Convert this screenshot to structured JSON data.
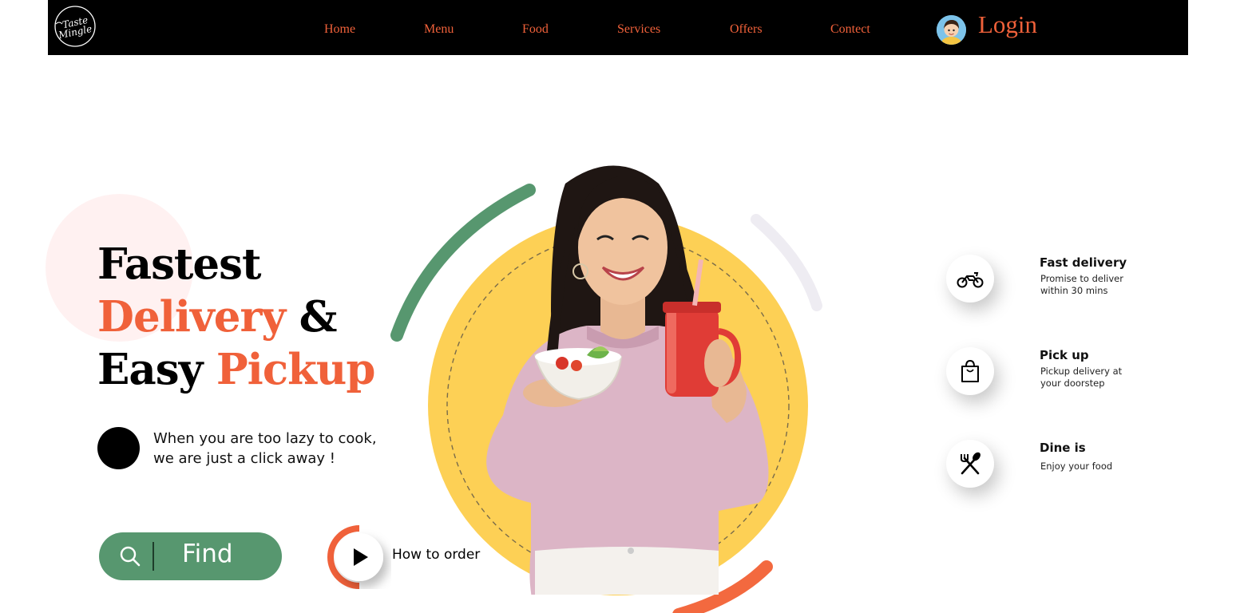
{
  "brand": {
    "logo_text_line1": "Taste",
    "logo_text_line2": "Mingle"
  },
  "nav": {
    "items": [
      {
        "label": "Home"
      },
      {
        "label": "Menu"
      },
      {
        "label": "Food"
      },
      {
        "label": "Services"
      },
      {
        "label": "Offers"
      },
      {
        "label": "Contect"
      }
    ],
    "login_label": "Login"
  },
  "hero": {
    "headline_line1": "Fastest",
    "headline_line2_accent": "Delivery",
    "headline_line2_rest": " &",
    "headline_line3_start": "Easy ",
    "headline_line3_accent": "Pickup",
    "tagline_line1": "When you are too lazy to cook,",
    "tagline_line2": "we are just a click away !",
    "find_label": "Find",
    "how_to_order_label": "How to order"
  },
  "features": [
    {
      "title": "Fast delivery",
      "desc_line1": "Promise to deliver",
      "desc_line2": "within 30 mins",
      "icon": "motorbike-icon"
    },
    {
      "title": "Pick up",
      "desc_line1": "Pickup delivery at",
      "desc_line2": "your doorstep",
      "icon": "shopping-bag-icon"
    },
    {
      "title": "Dine is",
      "desc_line1": "Enjoy your food",
      "desc_line2": "",
      "icon": "fork-spoon-icon"
    }
  ],
  "colors": {
    "accent": "#f0613a",
    "green": "#57976f",
    "yellow": "#fdd055",
    "nav_bg": "#000000",
    "pink_blob": "#fff1f1"
  }
}
